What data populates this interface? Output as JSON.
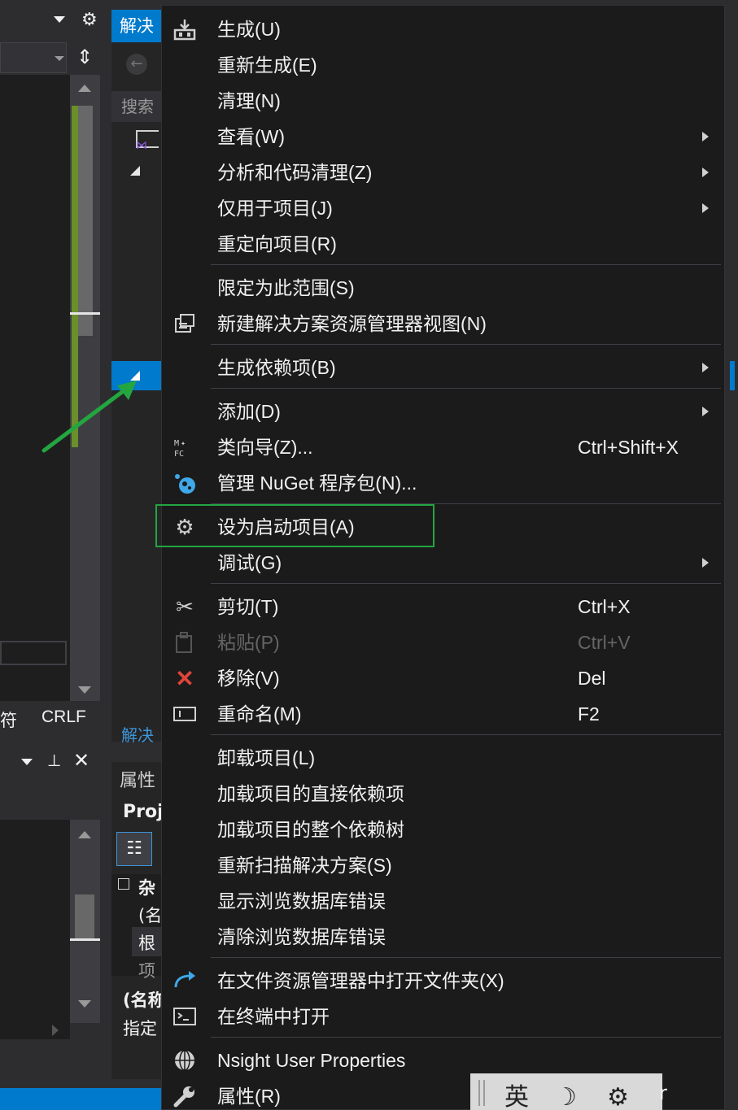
{
  "solution_explorer": {
    "header_title": "解决",
    "search_placeholder": "搜索",
    "footer_tab": "解决"
  },
  "editor": {
    "status": {
      "left_text": "符",
      "line_ending": "CRLF"
    }
  },
  "properties": {
    "header_title": "属性",
    "object_name": "Proj",
    "category": "杂",
    "rows": [
      "(名",
      "根",
      "项"
    ],
    "desc_title": "(名称",
    "desc_text": "指定"
  },
  "context_menu": {
    "items": [
      {
        "label": "生成(U)",
        "icon": "build-icon"
      },
      {
        "label": "重新生成(E)"
      },
      {
        "label": "清理(N)"
      },
      {
        "label": "查看(W)",
        "submenu": true
      },
      {
        "label": "分析和代码清理(Z)",
        "submenu": true
      },
      {
        "label": "仅用于项目(J)",
        "submenu": true
      },
      {
        "label": "重定向项目(R)"
      },
      {
        "label": "限定为此范围(S)"
      },
      {
        "label": "新建解决方案资源管理器视图(N)",
        "icon": "new-view-icon"
      },
      {
        "label": "生成依赖项(B)",
        "submenu": true
      },
      {
        "label": "添加(D)",
        "submenu": true
      },
      {
        "label": "类向导(Z)...",
        "shortcut": "Ctrl+Shift+X",
        "icon": "class-wizard-icon"
      },
      {
        "label": "管理 NuGet 程序包(N)...",
        "icon": "nuget-icon"
      },
      {
        "label": "设为启动项目(A)",
        "icon": "gear-icon"
      },
      {
        "label": "调试(G)",
        "submenu": true
      },
      {
        "label": "剪切(T)",
        "shortcut": "Ctrl+X",
        "icon": "scissors-icon"
      },
      {
        "label": "粘贴(P)",
        "shortcut": "Ctrl+V",
        "icon": "paste-icon",
        "disabled": true
      },
      {
        "label": "移除(V)",
        "shortcut": "Del",
        "icon": "remove-icon"
      },
      {
        "label": "重命名(M)",
        "shortcut": "F2",
        "icon": "rename-icon"
      },
      {
        "label": "卸载项目(L)"
      },
      {
        "label": "加载项目的直接依赖项"
      },
      {
        "label": "加载项目的整个依赖树"
      },
      {
        "label": "重新扫描解决方案(S)"
      },
      {
        "label": "显示浏览数据库错误"
      },
      {
        "label": "清除浏览数据库错误"
      },
      {
        "label": "在文件资源管理器中打开文件夹(X)",
        "icon": "open-folder-arrow-icon"
      },
      {
        "label": "在终端中打开",
        "icon": "terminal-icon"
      },
      {
        "label": "Nsight User Properties",
        "icon": "nsight-icon"
      },
      {
        "label": "属性(R)",
        "icon": "wrench-icon"
      }
    ]
  },
  "ime_toolbar": {
    "mode": "英",
    "trailing": "r"
  },
  "colors": {
    "accent": "#007acc",
    "highlight_box": "#23a540",
    "arrow": "#23a540",
    "remove_icon": "#e0453a",
    "nuget_icon": "#3fa8e8"
  }
}
